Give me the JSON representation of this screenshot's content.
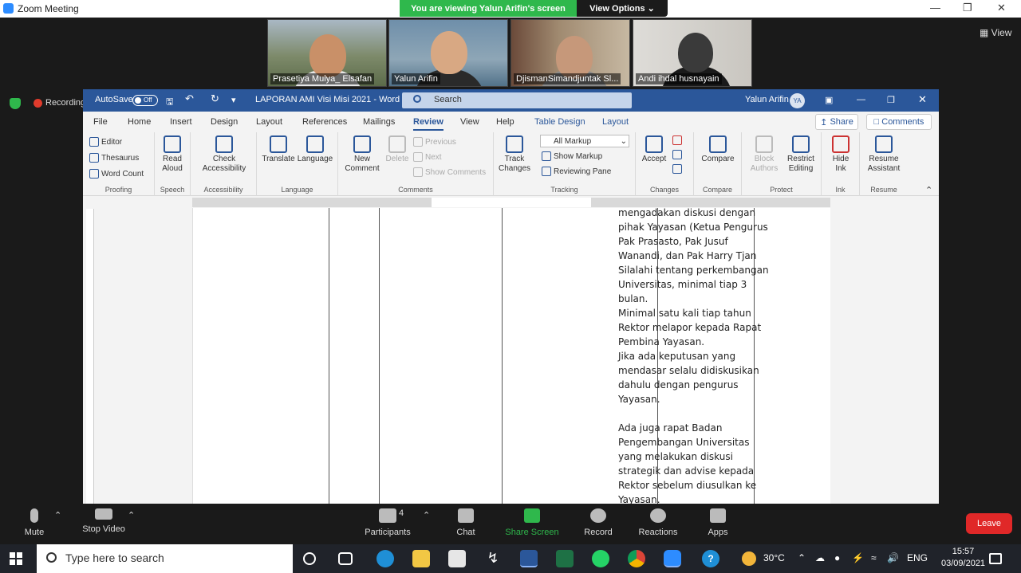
{
  "zoom": {
    "title": "Zoom Meeting",
    "viewing_banner": "You are viewing Yalun Arifin's screen",
    "view_options": "View Options",
    "view_button": "View",
    "recording": "Recording",
    "participants": [
      {
        "name": "Prasetiya Mulya_ Elsafan"
      },
      {
        "name": "Yalun Arifin"
      },
      {
        "name": "DjismanSimandjuntak Sl..."
      },
      {
        "name": "Andi ihdal husnayain"
      }
    ],
    "toolbar": {
      "mute": "Mute",
      "stop_video": "Stop Video",
      "participants": "Participants",
      "participants_count": "4",
      "chat": "Chat",
      "share_screen": "Share Screen",
      "record": "Record",
      "reactions": "Reactions",
      "apps": "Apps",
      "leave": "Leave"
    }
  },
  "word": {
    "autosave": "AutoSave",
    "autosave_state": "Off",
    "doc_title": "LAPORAN AMI Visi Misi 2021  -  Word",
    "search_placeholder": "Search",
    "user_name": "Yalun Arifin",
    "user_initials": "YA",
    "menu": [
      "File",
      "Home",
      "Insert",
      "Design",
      "Layout",
      "References",
      "Mailings",
      "Review",
      "View",
      "Help",
      "Table Design",
      "Layout"
    ],
    "share": "Share",
    "comments": "Comments",
    "ribbon": {
      "proofing": {
        "label": "Proofing",
        "editor": "Editor",
        "thesaurus": "Thesaurus",
        "word_count": "Word Count"
      },
      "speech": {
        "label": "Speech",
        "read_aloud": "Read Aloud"
      },
      "accessibility": {
        "label": "Accessibility",
        "check": "Check Accessibility"
      },
      "language": {
        "label": "Language",
        "translate": "Translate",
        "language": "Language"
      },
      "comments": {
        "label": "Comments",
        "new": "New Comment",
        "delete": "Delete",
        "previous": "Previous",
        "next": "Next",
        "show": "Show Comments"
      },
      "tracking": {
        "label": "Tracking",
        "track": "Track Changes",
        "markup_select": "All Markup",
        "show_markup": "Show Markup",
        "reviewing_pane": "Reviewing Pane"
      },
      "changes": {
        "label": "Changes",
        "accept": "Accept"
      },
      "compare": {
        "label": "Compare",
        "compare": "Compare"
      },
      "protect": {
        "label": "Protect",
        "block": "Block Authors",
        "restrict": "Restrict Editing"
      },
      "ink": {
        "label": "Ink",
        "hide": "Hide Ink"
      },
      "resume": {
        "label": "Resume",
        "assistant": "Resume Assistant"
      }
    },
    "document": {
      "paragraph1": "mengadakan diskusi dengan pihak Yayasan (Ketua Pengurus Pak Prasasto, Pak Jusuf Wanandi, dan Pak Harry Tjan Silalahi tentang perkembangan Universitas, minimal tiap 3 bulan.",
      "paragraph2": "Minimal satu kali tiap tahun Rektor melapor kepada Rapat Pembina Yayasan.",
      "paragraph3": "Jika ada keputusan yang mendasar selalu didiskusikan dahulu dengan pengurus Yayasan.",
      "paragraph4": "Ada juga rapat Badan Pengembangan Universitas yang melakukan diskusi strategik dan advise kepada Rektor sebelum diusulkan ke Yayasan."
    }
  },
  "taskbar": {
    "search_placeholder": "Type here to search",
    "temperature": "30°C",
    "language": "ENG",
    "time": "15:57",
    "date": "03/09/2021"
  }
}
